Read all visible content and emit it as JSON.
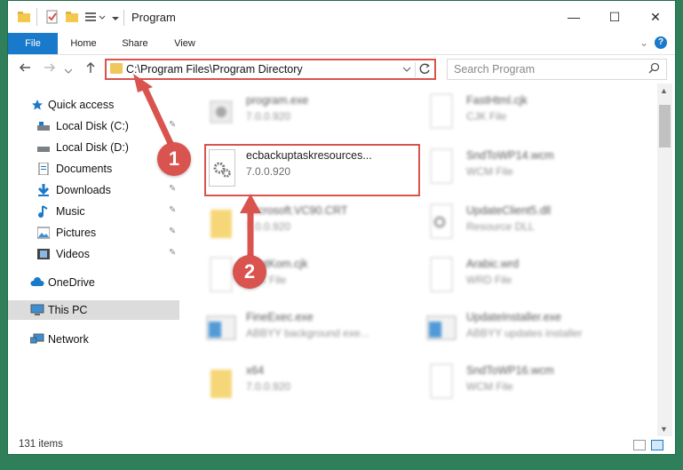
{
  "window": {
    "title": "Program",
    "minimize_glyph": "—",
    "maximize_glyph": "☐",
    "close_glyph": "✕"
  },
  "ribbon": {
    "tabs": [
      "File",
      "Home",
      "Share",
      "View"
    ],
    "collapse_glyph": "⌄",
    "help_glyph": "?"
  },
  "nav": {
    "address": "C:\\Program Files\\Program Directory",
    "search_placeholder": "Search Program"
  },
  "sidebar": {
    "items": [
      {
        "label": "Quick access",
        "icon": "star-icon",
        "pinned": false
      },
      {
        "label": "Local Disk (C:)",
        "icon": "drive-icon",
        "pinned": true
      },
      {
        "label": "Local Disk (D:)",
        "icon": "drive-icon",
        "pinned": false
      },
      {
        "label": "Documents",
        "icon": "documents-icon",
        "pinned": true
      },
      {
        "label": "Downloads",
        "icon": "downloads-icon",
        "pinned": true
      },
      {
        "label": "Music",
        "icon": "music-icon",
        "pinned": true
      },
      {
        "label": "Pictures",
        "icon": "pictures-icon",
        "pinned": true
      },
      {
        "label": "Videos",
        "icon": "videos-icon",
        "pinned": true
      },
      {
        "label": "OneDrive",
        "icon": "cloud-icon",
        "pinned": false
      },
      {
        "label": "This PC",
        "icon": "pc-icon",
        "pinned": false,
        "selected": true
      },
      {
        "label": "Network",
        "icon": "network-icon",
        "pinned": false
      }
    ]
  },
  "files": {
    "left": [
      {
        "name": "program.exe",
        "sub": "7.0.0.920",
        "icon": "exe-icon",
        "blurred": true
      },
      {
        "name": "ecbackuptaskresources...",
        "sub": "7.0.0.920",
        "icon": "dll-gear-icon",
        "blurred": false,
        "highlighted": true
      },
      {
        "name": "Microsoft.VC90.CRT",
        "sub": "7.0.0.920",
        "icon": "folder-icon",
        "blurred": true
      },
      {
        "name": "FontKom.cjk",
        "sub": "CJK File",
        "icon": "document-icon",
        "blurred": true
      },
      {
        "name": "FineExec.exe",
        "sub": "ABBYY background exe...",
        "icon": "exe-icon",
        "blurred": true
      },
      {
        "name": "x64",
        "sub": "7.0.0.920",
        "icon": "folder-icon",
        "blurred": true
      }
    ],
    "right": [
      {
        "name": "FastHtml.cjk",
        "sub": "CJK File",
        "icon": "document-icon",
        "blurred": true
      },
      {
        "name": "SndToWP14.wcm",
        "sub": "WCM File",
        "icon": "document-icon",
        "blurred": true
      },
      {
        "name": "UpdateClient5.dll",
        "sub": "Resource DLL",
        "icon": "dll-gear-icon",
        "blurred": true
      },
      {
        "name": "Arabic.wrd",
        "sub": "WRD File",
        "icon": "document-icon",
        "blurred": true
      },
      {
        "name": "UpdateInstaller.exe",
        "sub": "ABBYY updates installer",
        "icon": "exe-icon",
        "blurred": true
      },
      {
        "name": "SndToWP16.wcm",
        "sub": "WCM File",
        "icon": "document-icon",
        "blurred": true
      }
    ]
  },
  "status": {
    "item_count": "131 items"
  },
  "annotations": {
    "markers": [
      "1",
      "2"
    ],
    "accent_color": "#d9534f"
  },
  "colors": {
    "accent": "#1979ca",
    "annotation": "#d9534f",
    "desktop": "#2f7f5a"
  }
}
